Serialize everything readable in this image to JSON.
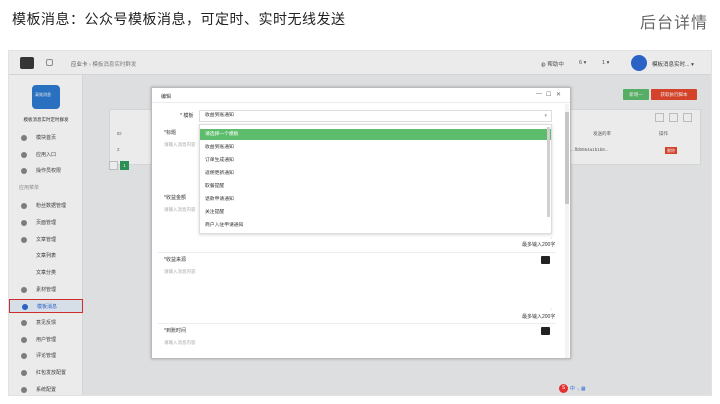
{
  "slide": {
    "title": "模板消息：公众号模板消息，可定时、实时无线发送",
    "right_label": "后台详情"
  },
  "topbar": {
    "breadcrumb_home": "应业卡",
    "breadcrumb_path": "模板消息实时群发",
    "help": "帮助中",
    "bell": "6",
    "user_icon": "1",
    "user_name": "模板消息实时..."
  },
  "sidebar": {
    "logo_text": "高效消息",
    "account": "模板消息实时定时群发",
    "items": [
      {
        "label": "模块首页",
        "type": "item"
      },
      {
        "label": "应用入口",
        "type": "item"
      },
      {
        "label": "操作员权限",
        "type": "item"
      },
      {
        "label": "应用菜单",
        "type": "group"
      },
      {
        "label": "粉丝数据管理",
        "type": "item"
      },
      {
        "label": "页面管理",
        "type": "item"
      },
      {
        "label": "文章管理",
        "type": "item"
      },
      {
        "label": "文章列表",
        "type": "sub"
      },
      {
        "label": "文章分类",
        "type": "sub"
      },
      {
        "label": "素材管理",
        "type": "item"
      },
      {
        "label": "模板消息",
        "type": "item",
        "active": true
      },
      {
        "label": "意见反馈",
        "type": "item"
      },
      {
        "label": "用户管理",
        "type": "item"
      },
      {
        "label": "评论管理",
        "type": "item"
      },
      {
        "label": "红包发放配置",
        "type": "item"
      },
      {
        "label": "系统配置",
        "type": "item"
      }
    ]
  },
  "main": {
    "add_button": "新增一",
    "run_button": "获取执行脚本",
    "col_id": "ID",
    "col_sent": "发送的率",
    "col_action": "操作",
    "row_id": "2",
    "row_sent": "...ffd0664a1b1b8...",
    "delete_button": "删除",
    "page_num": "1"
  },
  "modal": {
    "title": "编辑",
    "controls": {
      "minimize": "—",
      "maximize": "☐",
      "close": "✕"
    },
    "template_label": "* 模板",
    "template_value": "收益到账通知",
    "dropdown_options": [
      {
        "label": "请选择一个模板",
        "selected": true
      },
      {
        "label": "收益到账通知"
      },
      {
        "label": "订单生成通知"
      },
      {
        "label": "返佣更新通知"
      },
      {
        "label": "取餐提醒"
      },
      {
        "label": "退款申请通知"
      },
      {
        "label": "关注提醒"
      },
      {
        "label": "商户入驻申请通知"
      }
    ],
    "fields": [
      {
        "label": "*标题",
        "placeholder": "请输入消息内容"
      },
      {
        "label": "*收益金额",
        "placeholder": "请输入消息内容"
      },
      {
        "label": "*收益来源",
        "placeholder": "请输入消息内容"
      },
      {
        "label": "*到账时间",
        "placeholder": "请输入消息内容"
      }
    ],
    "count_text": "最多输入200字"
  },
  "ime": {
    "logo": "S",
    "text": "中 ·, ▦"
  }
}
